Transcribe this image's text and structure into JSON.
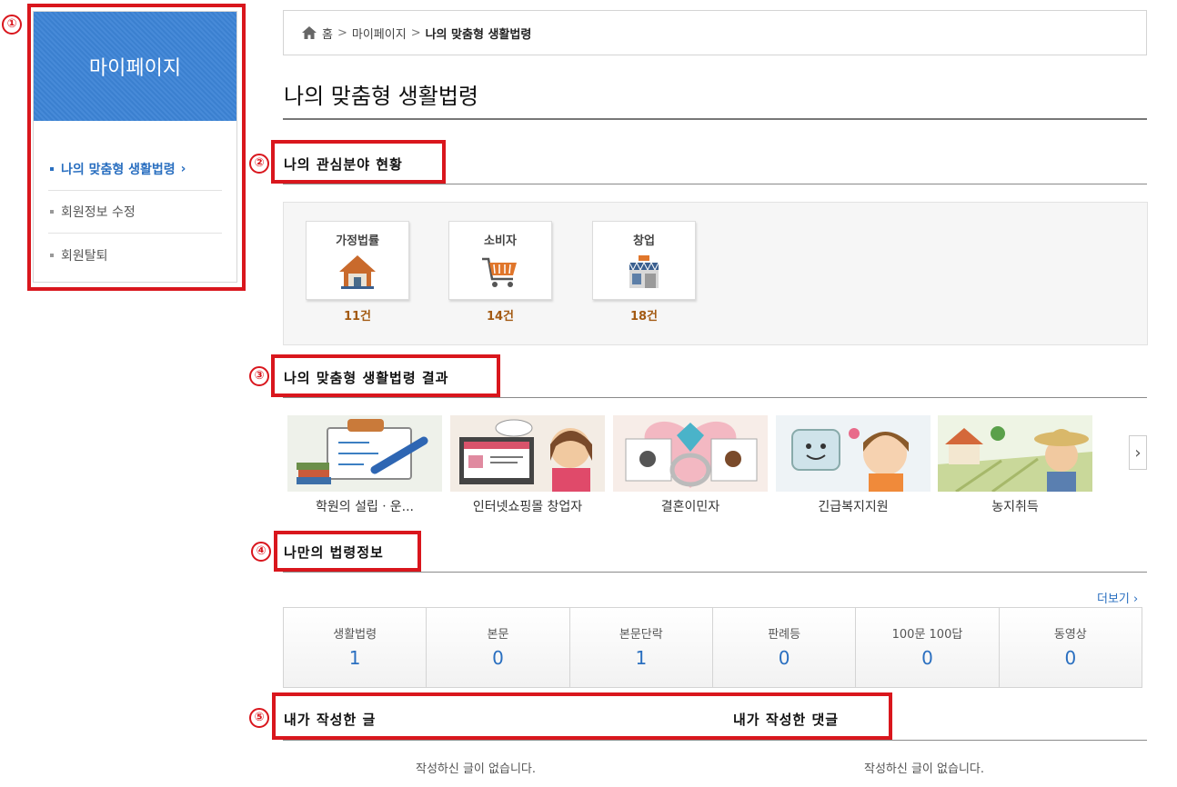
{
  "annotations": [
    "①",
    "②",
    "③",
    "④",
    "⑤"
  ],
  "sidebar": {
    "title": "마이페이지",
    "items": [
      {
        "label": "나의 맞춤형 생활법령",
        "active": true,
        "chevron": "›"
      },
      {
        "label": "회원정보 수정",
        "active": false
      },
      {
        "label": "회원탈퇴",
        "active": false
      }
    ]
  },
  "breadcrumb": {
    "home": "홈",
    "sep1": ">",
    "mypage": "마이페이지",
    "sep2": ">",
    "current": "나의 맞춤형 생활법령"
  },
  "page_title": "나의 맞춤형 생활법령",
  "interest": {
    "title": "나의 관심분야 현황",
    "cards": [
      {
        "label": "가정법률",
        "count": "11건",
        "icon": "house-icon"
      },
      {
        "label": "소비자",
        "count": "14건",
        "icon": "cart-icon"
      },
      {
        "label": "창업",
        "count": "18건",
        "icon": "store-icon"
      }
    ]
  },
  "results": {
    "title": "나의 맞춤형 생활법령 결과",
    "cards": [
      {
        "label": "학원의 설립ㆍ운..."
      },
      {
        "label": "인터넷쇼핑몰 창업자"
      },
      {
        "label": "결혼이민자"
      },
      {
        "label": "긴급복지지원"
      },
      {
        "label": "농지취득"
      }
    ],
    "next": "›"
  },
  "lawinfo": {
    "title": "나만의 법령정보",
    "more": "더보기 ›",
    "stats": [
      {
        "label": "생활법령",
        "value": "1"
      },
      {
        "label": "본문",
        "value": "0"
      },
      {
        "label": "본문단락",
        "value": "1"
      },
      {
        "label": "판례등",
        "value": "0"
      },
      {
        "label": "100문 100답",
        "value": "0"
      },
      {
        "label": "동영상",
        "value": "0"
      }
    ]
  },
  "posts": {
    "title_posts": "내가 작성한 글",
    "title_comments": "내가 작성한 댓글",
    "empty_posts": "작성하신 글이 없습니다.",
    "empty_comments": "작성하신 글이 없습니다."
  },
  "colors": {
    "accent": "#2a6fc0",
    "annotation_red": "#d9161d",
    "count_brown": "#a35a12",
    "sidebar_head": "#3d84d6"
  }
}
